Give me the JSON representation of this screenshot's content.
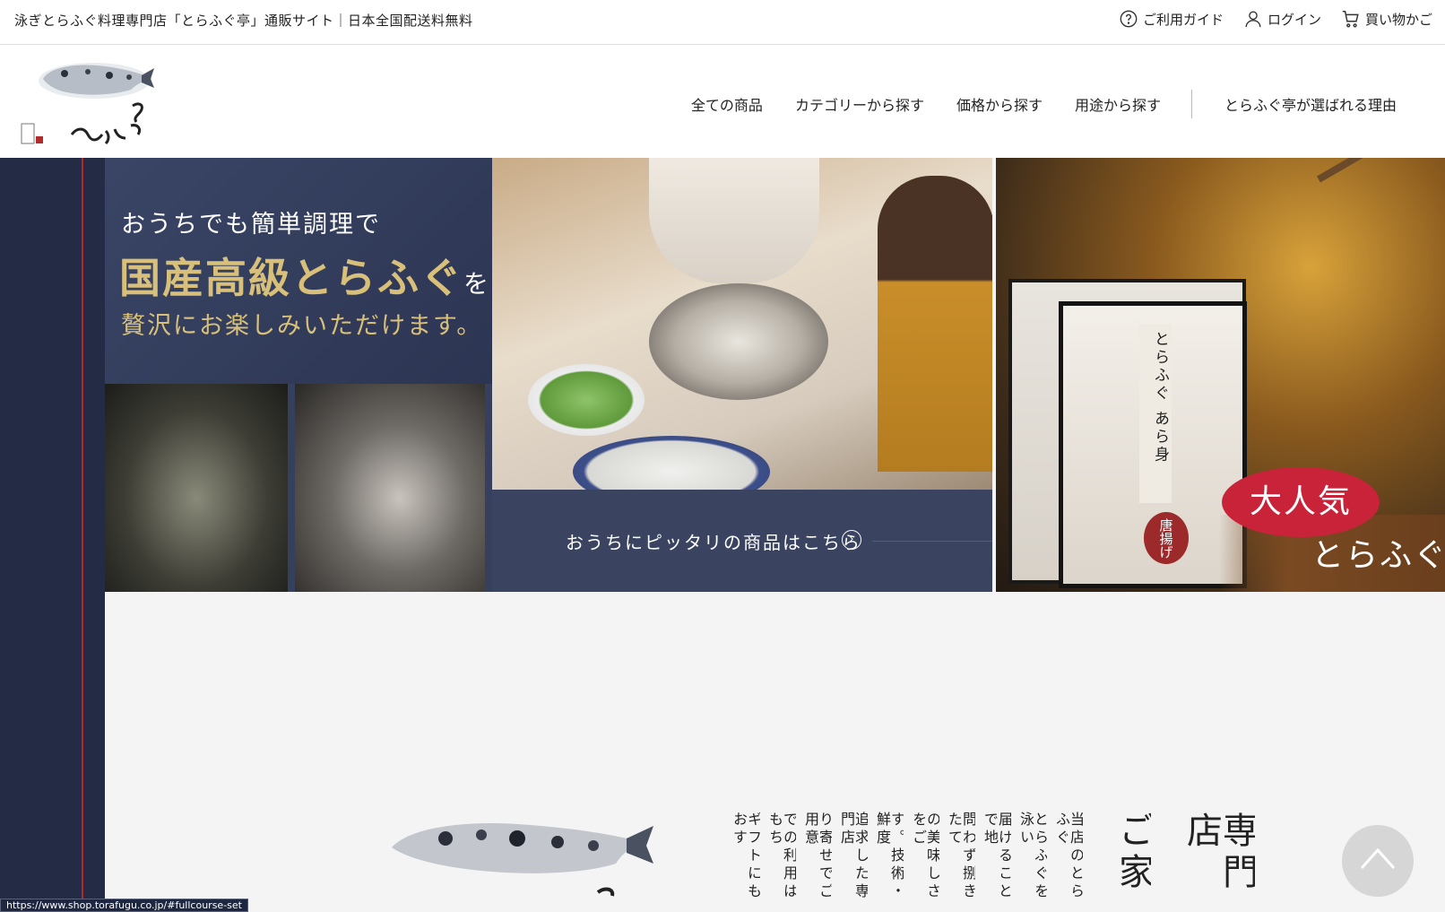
{
  "topbar": {
    "tagline": "泳ぎとらふぐ料理専門店「とらふぐ亭」通販サイト｜日本全国配送料無料",
    "links": [
      {
        "label": "ご利用ガイド",
        "icon": "question-circle-icon"
      },
      {
        "label": "ログイン",
        "icon": "user-icon"
      },
      {
        "label": "買い物かご",
        "icon": "cart-icon"
      }
    ]
  },
  "header": {
    "nav": [
      "全ての商品",
      "カテゴリーから探す",
      "価格から探す",
      "用途から探す",
      "とらふぐ亭が選ばれる理由"
    ]
  },
  "slider": {
    "slide1": {
      "line1": "おうちでも簡単調理で",
      "line2": "国産高級とらふぐ",
      "line2_suffix": "を",
      "line3": "贅沢にお楽しみいただけます。",
      "cta": "おうちにピッタリの商品はこちら"
    },
    "slide2": {
      "box_label": "とらふぐ あら身",
      "karaage": "唐揚げ",
      "badge": "大人気",
      "bottom": "とらふぐ"
    },
    "dots": 4,
    "active_dot": 4
  },
  "content": {
    "heading_cols": [
      "専門店",
      "ご家"
    ],
    "body_cols": [
      "当店のとらふぐ",
      "とらふぐを泳い",
      "届けることで地",
      "問わず捌きたて",
      "の美味しさをご",
      "す。技術・鮮度",
      "追求した専門店",
      "り寄せでご用意",
      "での利用はもち",
      "ギフトにもおす"
    ]
  },
  "status_url": "https://www.shop.torafugu.co.jp/#fullcourse-set",
  "colors": {
    "navy": "#232b45",
    "accent_red": "#b22a2a",
    "gold": "#d9c07a",
    "badge_red": "#c9233a"
  }
}
